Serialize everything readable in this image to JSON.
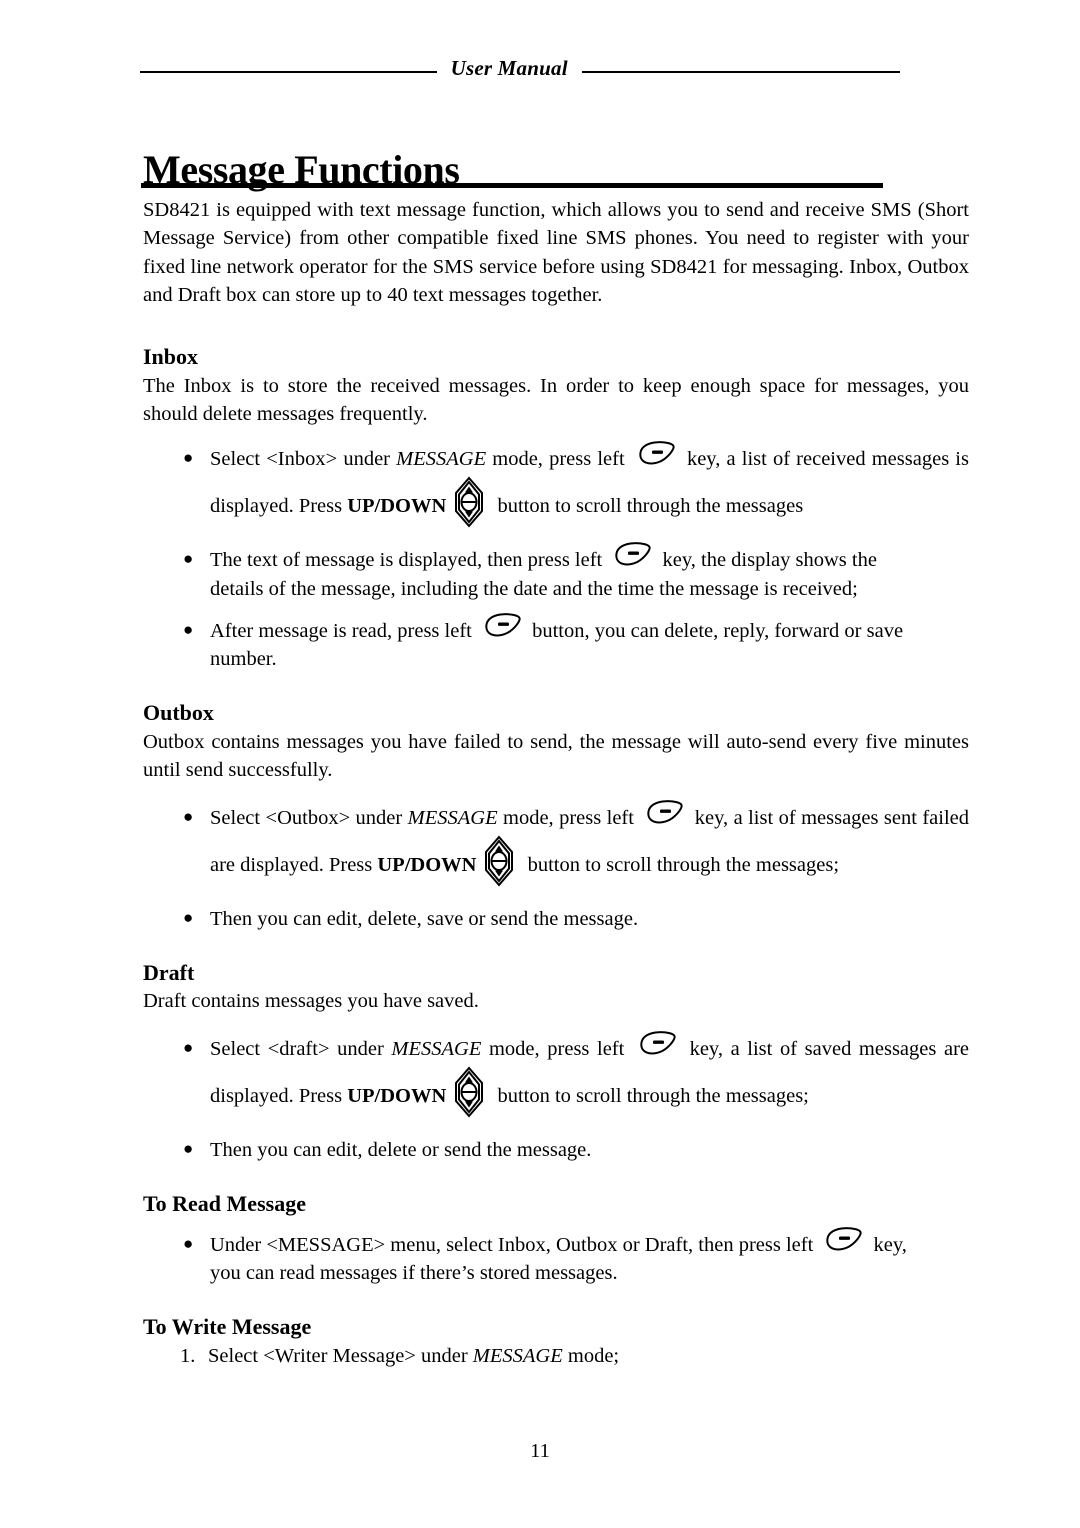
{
  "header": {
    "running_title": "User Manual"
  },
  "chapter": {
    "title": "Message Functions"
  },
  "intro": {
    "text": "SD8421 is equipped with text message function, which allows you to send and receive SMS (Short Message Service) from other compatible fixed line SMS phones. You need to register with your fixed line network operator for the SMS service before using SD8421 for messaging. Inbox, Outbox and Draft box can store up to 40 text messages together."
  },
  "sections": {
    "inbox": {
      "heading": "Inbox",
      "intro": "The Inbox is to store the received messages. In order to keep enough space for messages, you should delete messages frequently.",
      "bullet1": {
        "part1": "Select <Inbox> under ",
        "emph1": "MESSAGE",
        "part2": " mode, press left ",
        "icon1": "softkey-icon",
        "part3": " key, a list of received messages is displayed. Press ",
        "strong1": "UP/DOWN",
        "icon2": "updown-key-icon",
        "part4": " button to scroll through the messages"
      },
      "bullet2": {
        "part1": "The text of message is displayed, then press left ",
        "icon1": "softkey-icon",
        "part2": " key, the display shows the",
        "part3": "details of the message, including the date and the time the message is received;"
      },
      "bullet3": {
        "part1": "After message is read, press left ",
        "icon1": "softkey-icon",
        "part2": " button, you can delete, reply, forward or save",
        "part3": "number."
      }
    },
    "outbox": {
      "heading": "Outbox",
      "intro": "Outbox contains messages you have failed to send, the message will auto-send every five minutes until send successfully.",
      "bullet1": {
        "part1": "Select <Outbox> under ",
        "emph1": "MESSAGE",
        "part2": " mode, press left ",
        "icon1": "softkey-icon",
        "part3": " key, a list of messages sent failed are displayed. Press ",
        "strong1": "UP/DOWN",
        "icon2": "updown-key-icon",
        "part4": " button to scroll through the messages;"
      },
      "bullet2": {
        "text": "Then you can edit, delete, save or send the message."
      }
    },
    "draft": {
      "heading": "Draft",
      "intro": "Draft contains messages you have saved.",
      "bullet1": {
        "part1": "Select <draft> under ",
        "emph1": "MESSAGE",
        "part2": " mode, press left ",
        "icon1": "softkey-icon",
        "part3": " key, a list of saved messages are displayed. Press ",
        "strong1": "UP/DOWN",
        "icon2": "updown-key-icon",
        "part4": " button to scroll through the messages;"
      },
      "bullet2": {
        "text": "Then you can edit, delete or send the message."
      }
    },
    "to_read": {
      "heading": "To Read Message",
      "bullet1": {
        "part1": "Under <MESSAGE> menu, select Inbox, Outbox or Draft, then press left ",
        "icon1": "softkey-icon",
        "part2": " key,",
        "part3": "you can read messages if there’s stored messages."
      }
    },
    "to_write": {
      "heading": "To Write Message",
      "item1": {
        "marker": "1.",
        "part1": "Select <Writer Message> under ",
        "emph1": "MESSAGE",
        "part2": " mode;"
      }
    }
  },
  "footer": {
    "page_number": "11"
  },
  "colors": {
    "ink": "#000000",
    "paper": "#ffffff"
  }
}
